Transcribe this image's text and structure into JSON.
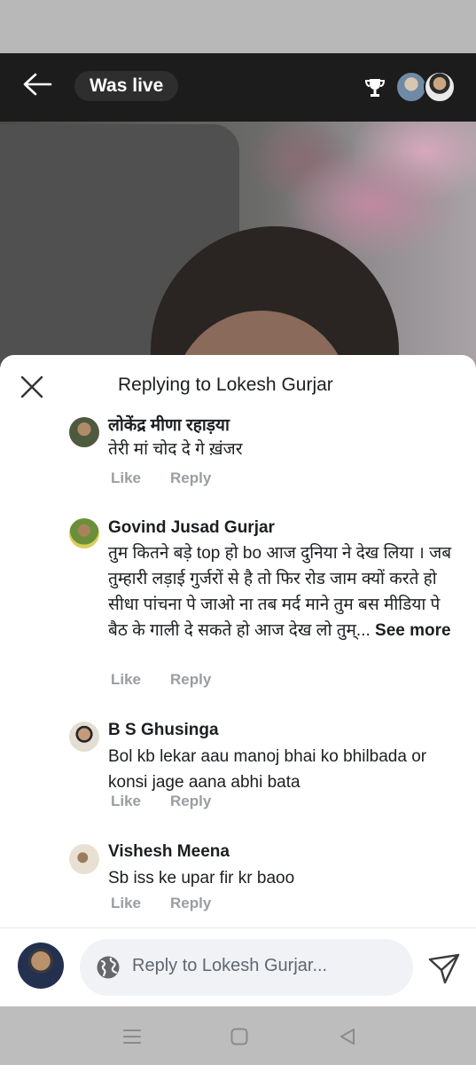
{
  "header": {
    "live_label": "Was live"
  },
  "sheet": {
    "title": "Replying to Lokesh Gurjar"
  },
  "comments": [
    {
      "author": "लोकेंद्र मीणा रहाड़या",
      "text": "तेरी मां चोद दे गे ख़ंजर",
      "like_label": "Like",
      "reply_label": "Reply"
    },
    {
      "author": "Govind Jusad Gurjar",
      "text": "तुम कितने बड़े top हो bo आज दुनिया ने देख लिया । जब तुम्हारी लड़ाई गुर्जरों से है तो फिर रोड जाम क्यों करते हो सीधा पांचना पे जाओ ना तब मर्द माने तुम बस मीडिया पे बैठ के गाली दे सकते हो आज देख लो तुम्...",
      "see_more": "See more",
      "like_label": "Like",
      "reply_label": "Reply"
    },
    {
      "author": "B S Ghusinga",
      "text": "Bol kb lekar aau manoj bhai ko bhilbada or konsi jage aana abhi bata",
      "like_label": "Like",
      "reply_label": "Reply"
    },
    {
      "author": "Vishesh Meena",
      "text": "Sb iss ke upar fir kr baoo",
      "like_label": "Like",
      "reply_label": "Reply"
    }
  ],
  "composer": {
    "placeholder": "Reply to Lokesh Gurjar..."
  },
  "icons": {
    "back": "arrow-left-icon",
    "trophy": "trophy-icon",
    "close": "close-icon",
    "globe": "globe-icon",
    "send": "send-icon",
    "nav_menu": "menu-icon",
    "nav_home": "home-icon",
    "nav_back": "nav-back-icon"
  }
}
